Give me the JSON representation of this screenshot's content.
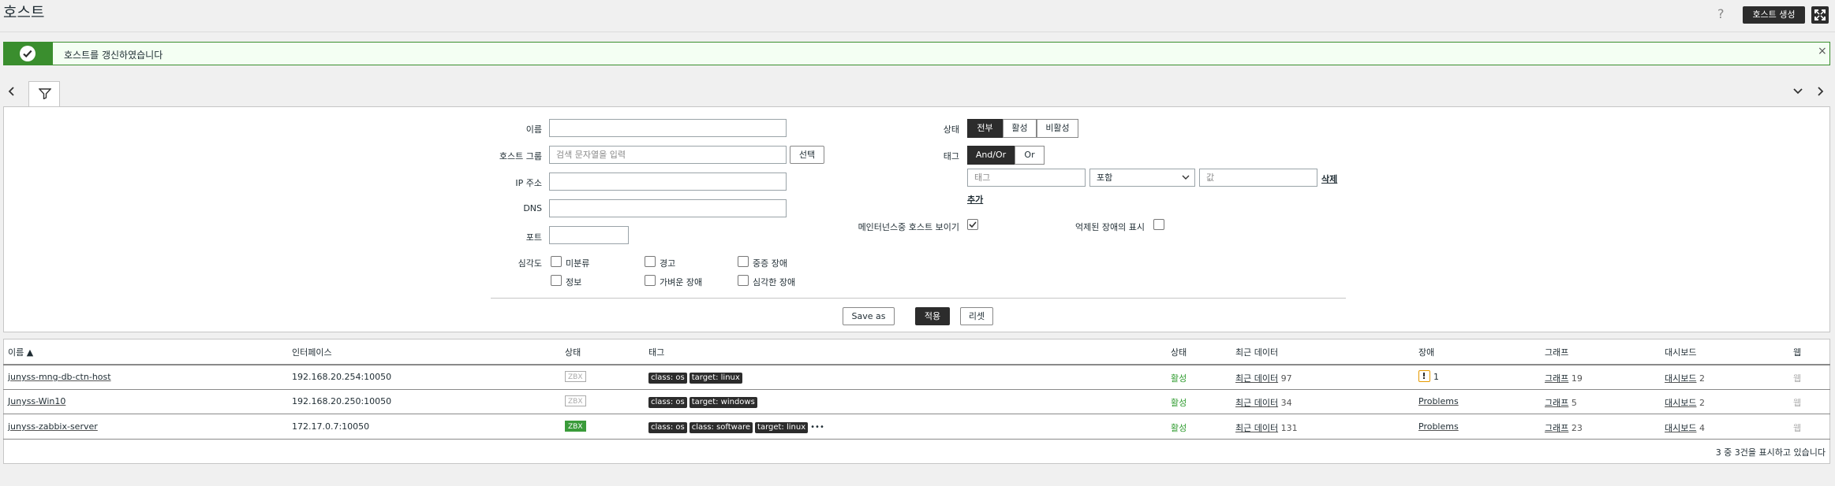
{
  "header": {
    "title": "호스트",
    "help": "?",
    "create_button": "호스트 생성"
  },
  "message": {
    "text": "호스트를 갱신하였습니다",
    "close": "×"
  },
  "filter": {
    "name_label": "이름",
    "hostgroup_label": "호스트 그룹",
    "hostgroup_placeholder": "검색 문자열을 입력",
    "select_button": "선택",
    "ip_label": "IP 주소",
    "dns_label": "DNS",
    "port_label": "포트",
    "severity_label": "심각도",
    "severities": [
      "미분류",
      "경고",
      "중증 장애",
      "정보",
      "가벼운 장애",
      "심각한 장애"
    ],
    "status_label": "상태",
    "status_options": [
      "전부",
      "활성",
      "비활성"
    ],
    "tag_label": "태그",
    "tag_ops": [
      "And/Or",
      "Or"
    ],
    "tag_placeholder": "태그",
    "tag_operator": "포함",
    "tag_value_placeholder": "값",
    "remove_link": "삭제",
    "add_link": "추가",
    "maint_label": "메인터넌스중 호스트 보이기",
    "suppressed_label": "억제된 장애의 표시",
    "save_as": "Save as",
    "apply": "적용",
    "reset": "리셋"
  },
  "table": {
    "headers": [
      "이름 ▲",
      "인터페이스",
      "상태",
      "태그",
      "상태",
      "최근 데이터",
      "장애",
      "그래프",
      "대시보드",
      "웹"
    ],
    "rows": [
      {
        "name": "junyss-mng-db-ctn-host",
        "iface": "192.168.20.254:10050",
        "zbx": "ZBX",
        "tags": [
          "class: os",
          "target: linux"
        ],
        "status": "활성",
        "latest": "최근 데이터",
        "latest_n": "97",
        "problems": "",
        "problem_count": "1",
        "graph": "그래프",
        "graph_n": "19",
        "dash": "대시보드",
        "dash_n": "2",
        "web": "웹"
      },
      {
        "name": "Junyss-Win10",
        "iface": "192.168.20.250:10050",
        "zbx": "ZBX",
        "tags": [
          "class: os",
          "target: windows"
        ],
        "status": "활성",
        "latest": "최근 데이터",
        "latest_n": "34",
        "problems": "Problems",
        "graph": "그래프",
        "graph_n": "5",
        "dash": "대시보드",
        "dash_n": "2",
        "web": "웹"
      },
      {
        "name": "junyss-zabbix-server",
        "iface": "172.17.0.7:10050",
        "zbx": "ZBX",
        "tags": [
          "class: os",
          "class: software",
          "target: linux"
        ],
        "more": "•••",
        "status": "활성",
        "latest": "최근 데이터",
        "latest_n": "131",
        "problems": "Problems",
        "graph": "그래프",
        "graph_n": "23",
        "dash": "대시보드",
        "dash_n": "4",
        "web": "웹"
      }
    ],
    "footer": "3 중 3건을 표시하고 있습니다"
  },
  "colors": {
    "accent_green": "#3a8e2e",
    "dark_button": "#2c2c2c",
    "warning": "#e69a00"
  }
}
